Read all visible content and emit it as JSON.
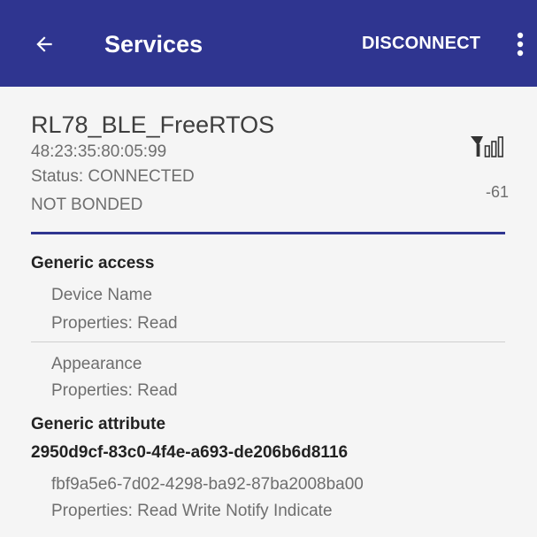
{
  "appbar": {
    "title": "Services",
    "action_label": "DISCONNECT",
    "back_icon": "arrow-back-icon",
    "overflow_icon": "more-vert-icon",
    "background_color": "#2f3590"
  },
  "device": {
    "name": "RL78_BLE_FreeRTOS",
    "address": "48:23:35:80:05:99",
    "status": "Status:  CONNECTED",
    "bond_state": "NOT BONDED",
    "rssi": "-61",
    "signal_icon": "signal-strength-icon"
  },
  "services": [
    {
      "title": "Generic access",
      "characteristics": [
        {
          "name": "Device Name",
          "properties": "Properties: Read"
        },
        {
          "name": "Appearance",
          "properties": "Properties: Read"
        }
      ]
    },
    {
      "title": "Generic attribute",
      "characteristics": []
    },
    {
      "title": "2950d9cf-83c0-4f4e-a693-de206b6d8116",
      "characteristics": [
        {
          "name": "fbf9a5e6-7d02-4298-ba92-87ba2008ba00",
          "properties": "Properties: Read Write Notify Indicate"
        }
      ]
    }
  ]
}
